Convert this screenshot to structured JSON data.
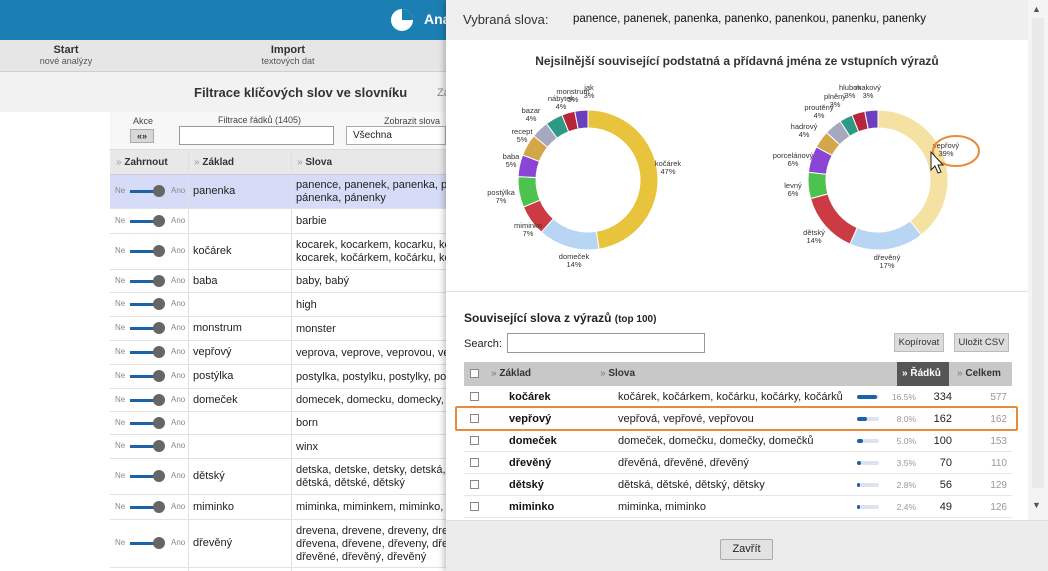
{
  "app": {
    "title": "Ana",
    "nav": [
      {
        "title": "Start",
        "sub": "nové analýzy"
      },
      {
        "title": "Import",
        "sub": "textových dat"
      }
    ],
    "page_title": "Filtrace klíčových slov ve slovníku",
    "page_title_extra": "Za"
  },
  "filters": {
    "akce_label": "Akce",
    "akce_btn": "«»",
    "filter_label": "Filtrace řádků (1405)",
    "show_label": "Zobrazit slova",
    "show_value": "Všechna"
  },
  "bg_table": {
    "headers": [
      "Zahrnout",
      "Základ",
      "Slova"
    ],
    "toggle_off": "Ne",
    "toggle_on": "Ano",
    "rows": [
      {
        "zaklad": "panenka",
        "slova": [
          "panence, panenek, panenka, p",
          "pánenka, pánenky"
        ]
      },
      {
        "zaklad": "",
        "slova": [
          "barbie"
        ]
      },
      {
        "zaklad": "kočárek",
        "slova": [
          "kocarek, kocarkem, kocarku, ko",
          "kocarek, kočárkem, kočárku, ko"
        ]
      },
      {
        "zaklad": "baba",
        "slova": [
          "baby, babý"
        ]
      },
      {
        "zaklad": "",
        "slova": [
          "high"
        ]
      },
      {
        "zaklad": "monstrum",
        "slova": [
          "monster"
        ]
      },
      {
        "zaklad": "vepřový",
        "slova": [
          "veprova, veprove, veprovou, ve"
        ]
      },
      {
        "zaklad": "postýlka",
        "slova": [
          "postylka, postylku, postylky, pos"
        ]
      },
      {
        "zaklad": "domeček",
        "slova": [
          "domecek, domecku, domecky, d"
        ]
      },
      {
        "zaklad": "",
        "slova": [
          "born"
        ]
      },
      {
        "zaklad": "",
        "slova": [
          "winx"
        ]
      },
      {
        "zaklad": "dětský",
        "slova": [
          "detska, detske, detsky, detská,",
          "dětská, dětské, dětský"
        ]
      },
      {
        "zaklad": "miminko",
        "slova": [
          "miminka, miminkem, miminko, m"
        ]
      },
      {
        "zaklad": "dřevěný",
        "slova": [
          "drevena, drevene, dreveny, dre",
          "dřevena, dřevene, dřeveny, dřev",
          "dřevěné, dřevěný, dřevěný"
        ]
      }
    ]
  },
  "modal": {
    "selected_label": "Vybraná slova:",
    "selected_words": "panence, panenek, panenka, panenko, panenkou, panenku, panenky",
    "chart_title": "Nejsilnější související podstatná a přídavná jména ze vstupních výrazů",
    "section_title": "Související slova z výrazů",
    "section_top": "(top 100)",
    "search_label": "Search:",
    "copy_btn": "Kopírovat",
    "csv_btn": "Uložit CSV",
    "table_headers": [
      "Základ",
      "Slova",
      "Řádků",
      "Celkem"
    ],
    "rows": [
      {
        "zaklad": "kočárek",
        "slova": "kočárek, kočárkem, kočárku, kočárky, kočárků",
        "pct": "16.5%",
        "pct_value": 16.5,
        "radku": "334",
        "celkem": "577"
      },
      {
        "zaklad": "vepřový",
        "slova": "vepřová, vepřové, vepřovou",
        "pct": "8.0%",
        "pct_value": 8.0,
        "radku": "162",
        "celkem": "162"
      },
      {
        "zaklad": "domeček",
        "slova": "domeček, domečku, domečky, domečků",
        "pct": "5.0%",
        "pct_value": 5.0,
        "radku": "100",
        "celkem": "153"
      },
      {
        "zaklad": "dřevěný",
        "slova": "dřevěná, dřevěné, dřevěný",
        "pct": "3.5%",
        "pct_value": 3.5,
        "radku": "70",
        "celkem": "110"
      },
      {
        "zaklad": "dětský",
        "slova": "dětská, dětské, dětský, dětsky",
        "pct": "2.8%",
        "pct_value": 2.8,
        "radku": "56",
        "celkem": "129"
      },
      {
        "zaklad": "miminko",
        "slova": "miminka, miminko",
        "pct": "2.4%",
        "pct_value": 2.4,
        "radku": "49",
        "celkem": "126"
      }
    ],
    "close_btn": "Zavřít"
  },
  "chart_data": [
    {
      "type": "pie",
      "title": "",
      "slices": [
        {
          "label": "kočárek",
          "value": 47,
          "text": "47%",
          "color": "#e8c33c"
        },
        {
          "label": "domeček",
          "value": 14,
          "text": "14%",
          "color": "#b8d6f3"
        },
        {
          "label": "miminko",
          "value": 7,
          "text": "7%",
          "color": "#cc3b43"
        },
        {
          "label": "postýlka",
          "value": 7,
          "text": "7%",
          "color": "#4ec24e"
        },
        {
          "label": "baba",
          "value": 5,
          "text": "5%",
          "color": "#8a44d6"
        },
        {
          "label": "recept",
          "value": 5,
          "text": "5%",
          "color": "#d4a64a"
        },
        {
          "label": "bazar",
          "value": 4,
          "text": "4%",
          "color": "#a6a8c0"
        },
        {
          "label": "nábytek",
          "value": 4,
          "text": "4%",
          "color": "#2e9a86"
        },
        {
          "label": "monstrum",
          "value": 3,
          "text": "3%",
          "color": "#b8253a"
        },
        {
          "label": "jak",
          "value": 3,
          "text": "3%",
          "color": "#6c3fbf"
        }
      ]
    },
    {
      "type": "pie",
      "title": "",
      "slices": [
        {
          "label": "vepřový",
          "value": 39,
          "text": "39%",
          "color": "#f5e2a2"
        },
        {
          "label": "dřevěný",
          "value": 17,
          "text": "17%",
          "color": "#b8d6f3"
        },
        {
          "label": "dětský",
          "value": 14,
          "text": "14%",
          "color": "#cc3b43"
        },
        {
          "label": "levný",
          "value": 6,
          "text": "6%",
          "color": "#4ec24e"
        },
        {
          "label": "porcelánový",
          "value": 6,
          "text": "6%",
          "color": "#8a44d6"
        },
        {
          "label": "hadrový",
          "value": 4,
          "text": "4%",
          "color": "#d4a64a"
        },
        {
          "label": "proutěný",
          "value": 4,
          "text": "4%",
          "color": "#a6a8c0"
        },
        {
          "label": "plněný",
          "value": 3,
          "text": "3%",
          "color": "#2e9a86"
        },
        {
          "label": "hlubok",
          "value": 3,
          "text": "3%",
          "color": "#b8253a"
        },
        {
          "label": "makový",
          "value": 3,
          "text": "3%",
          "color": "#6c3fbf"
        }
      ]
    }
  ]
}
